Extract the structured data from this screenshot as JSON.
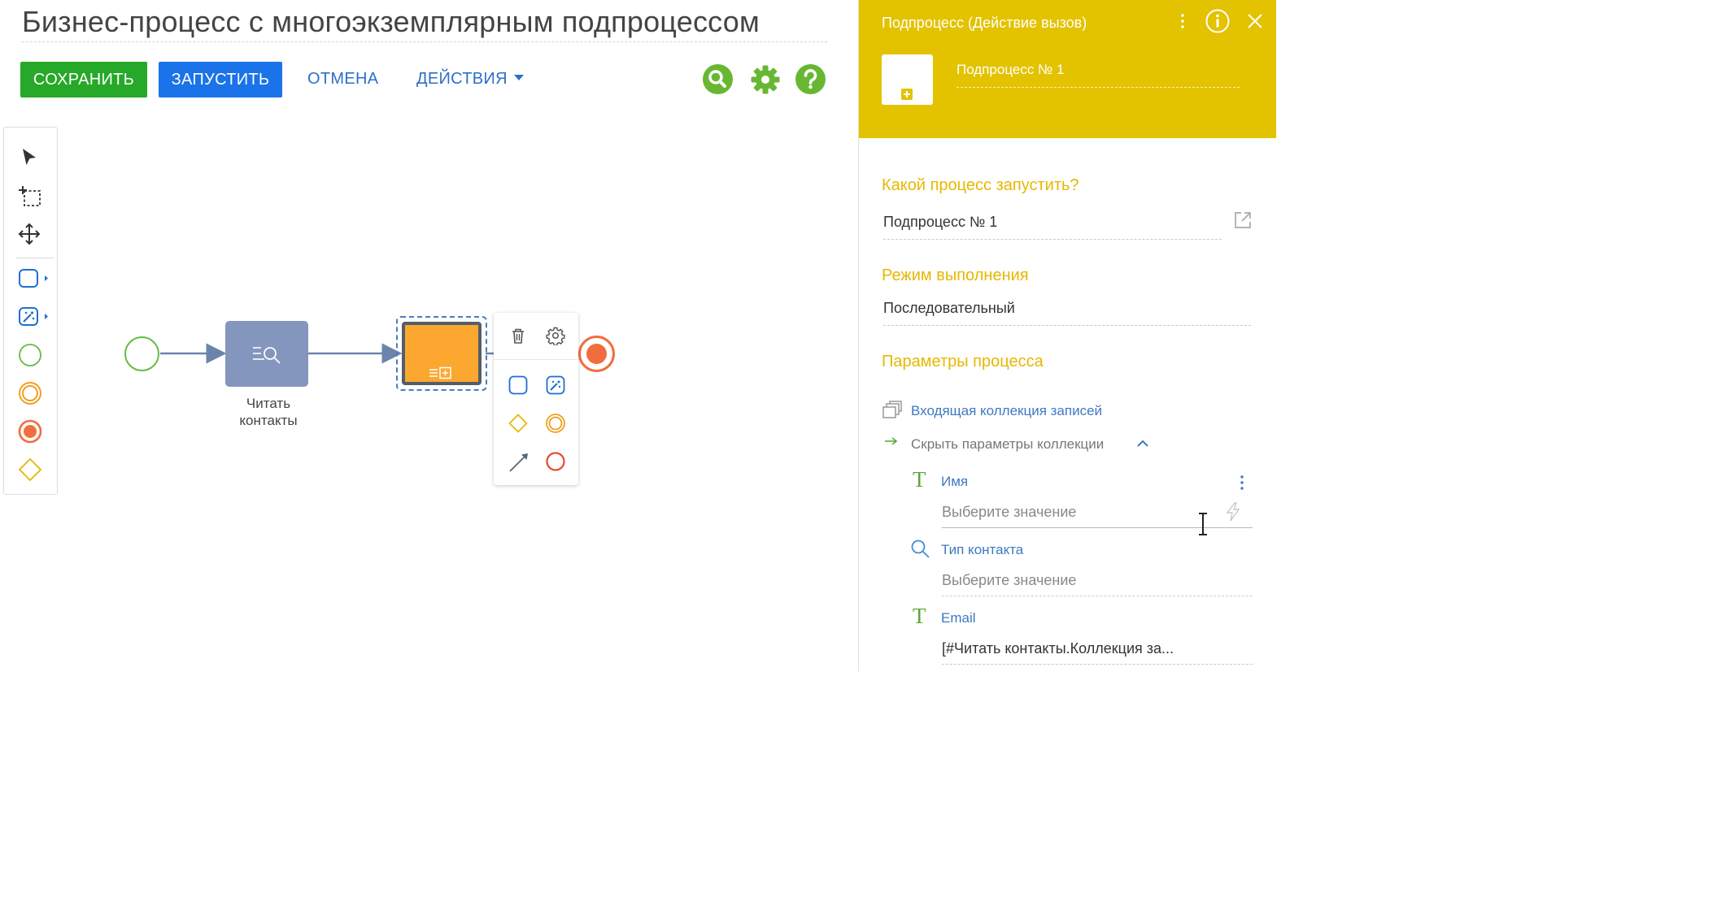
{
  "page": {
    "title": "Бизнес-процесс с многоэкземплярным подпроцессом"
  },
  "toolbar": {
    "save_label": "СОХРАНИТЬ",
    "run_label": "ЗАПУСТИТЬ",
    "cancel_label": "ОТМЕНА",
    "actions_label": "ДЕЙСТВИЯ"
  },
  "header_icons": [
    "search-icon",
    "gear-icon",
    "help-icon"
  ],
  "colors": {
    "save": "#26a828",
    "run": "#1a73e8",
    "link": "#2e6fc9",
    "green_icon": "#68b733",
    "panel_header": "#e3c200",
    "section_heading": "#e6b800",
    "task_read": "#8496bd",
    "task_sub": "#fba730",
    "end_event": "#f26d3d",
    "start_event": "#66bb44"
  },
  "palette_tools": [
    "pointer-tool-icon",
    "lasso-select-icon",
    "pan-tool-icon",
    "task-shape-icon",
    "magic-task-icon",
    "start-event-icon",
    "intermediate-event-icon",
    "end-event-icon",
    "gateway-icon"
  ],
  "diagram": {
    "read_task_label": "Читать контакты"
  },
  "context_menu": [
    "delete-icon",
    "settings-icon",
    "task-shape-icon",
    "magic-task-icon",
    "gateway-icon",
    "intermediate-event-icon",
    "connector-arrow-icon",
    "end-event-icon"
  ],
  "panel": {
    "title": "Подпроцесс (Действие вызов)",
    "element_name": "Подпроцесс № 1",
    "q_process": "Какой процесс запустить?",
    "process_value": "Подпроцесс № 1",
    "mode_heading": "Режим выполнения",
    "mode_value": "Последовательный",
    "params_heading": "Параметры процесса",
    "collection_link": "Входящая коллекция записей",
    "hide_params": "Скрыть параметры коллекции",
    "params": [
      {
        "icon": "text-type-icon",
        "name": "Имя",
        "value": "",
        "placeholder": "Выберите значение"
      },
      {
        "icon": "lookup-type-icon",
        "name": "Тип контакта",
        "value": "",
        "placeholder": "Выберите значение"
      },
      {
        "icon": "text-type-icon",
        "name": "Email",
        "value": "[#Читать контакты.Коллекция за...",
        "placeholder": ""
      }
    ]
  }
}
